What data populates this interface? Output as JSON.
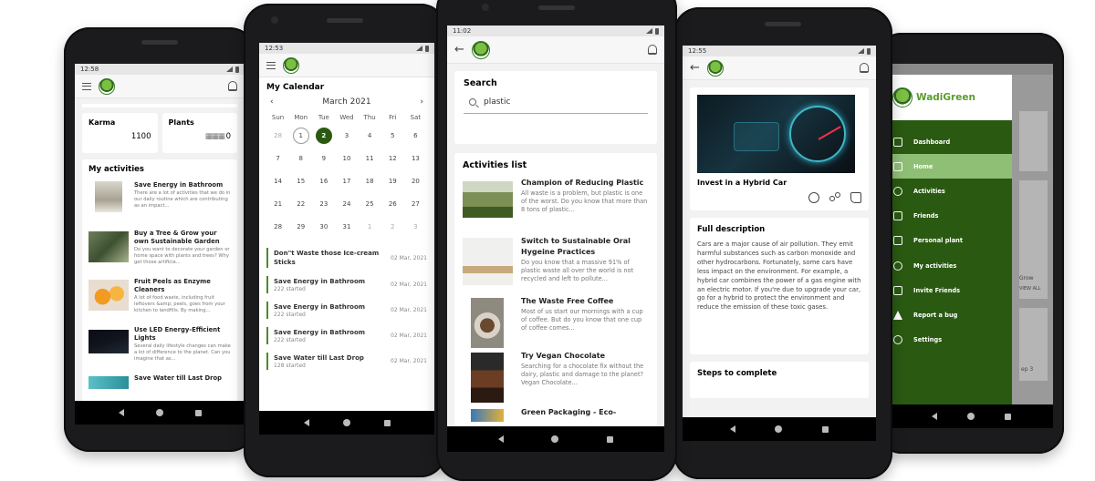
{
  "phone1": {
    "time": "12:58",
    "stats": [
      {
        "label": "Karma",
        "value": "1100"
      },
      {
        "label": "Plants",
        "value": "0"
      }
    ],
    "activities_heading": "My activities",
    "activities": [
      {
        "title": "Save Energy in Bathroom",
        "desc": "There are a lot of activities that we do in our daily routine which are contributing as an impact..."
      },
      {
        "title": "Buy a Tree & Grow your own Sustainable Garden",
        "desc": "Do you want to decorate your garden or home space with plants and trees? Why get those artificia..."
      },
      {
        "title": "Fruit Peels as Enzyme Cleaners",
        "desc": "A lot of food waste, including fruit leftovers &amp; peels, goes from your kitchen to landfills. By making..."
      },
      {
        "title": "Use LED Energy-Efficient Lights",
        "desc": "Several daily lifestyle changes can make a lot of difference to the planet. Can you imagine that as..."
      },
      {
        "title": "Save Water till Last Drop",
        "desc": ""
      }
    ]
  },
  "phone2": {
    "time": "12:53",
    "heading": "My Calendar",
    "month": "March 2021",
    "weekdays": [
      "Sun",
      "Mon",
      "Tue",
      "Wed",
      "Thu",
      "Fri",
      "Sat"
    ],
    "days": [
      "28",
      "1",
      "2",
      "3",
      "4",
      "5",
      "6",
      "7",
      "8",
      "9",
      "10",
      "11",
      "12",
      "13",
      "14",
      "15",
      "16",
      "17",
      "18",
      "19",
      "20",
      "21",
      "22",
      "23",
      "24",
      "25",
      "26",
      "27",
      "28",
      "29",
      "30",
      "31",
      "1",
      "2",
      "3"
    ],
    "events": [
      {
        "title": "Don\"t Waste those Ice-cream Sticks",
        "sub": "",
        "date": "02 Mar, 2021"
      },
      {
        "title": "Save Energy in Bathroom",
        "sub": "222 started",
        "date": "02 Mar, 2021"
      },
      {
        "title": "Save Energy in Bathroom",
        "sub": "222 started",
        "date": "02 Mar, 2021"
      },
      {
        "title": "Save Energy in Bathroom",
        "sub": "222 started",
        "date": "02 Mar, 2021"
      },
      {
        "title": "Save Water till Last Drop",
        "sub": "128 started",
        "date": "02 Mar, 2021"
      }
    ]
  },
  "phone3": {
    "time": "11:02",
    "search_heading": "Search",
    "search_value": "plastic",
    "list_heading": "Activities list",
    "items": [
      {
        "title": "Champion of Reducing Plastic",
        "desc": "All waste is a problem, but plastic is one of the worst. Do you know that more than 8 tons of plastic..."
      },
      {
        "title": "Switch to Sustainable Oral Hygeine Practices",
        "desc": "Do you know that a massive 91% of plastic waste all over the world is not recycled and left to pollute..."
      },
      {
        "title": "The Waste Free Coffee",
        "desc": "Most of us start our mornings with a cup of coffee. But do you know that one cup of coffee comes..."
      },
      {
        "title": "Try Vegan Chocolate",
        "desc": "Searching for a chocolate fix without the dairy, plastic and damage to the planet? Vegan Chocolate..."
      },
      {
        "title": "Green Packaging - Eco-",
        "desc": ""
      }
    ]
  },
  "phone4": {
    "time": "12:55",
    "title": "Invest in a Hybrid Car",
    "desc_heading": "Full description",
    "description": "Cars are a major cause of air pollution. They emit harmful substances such as carbon monoxide and other hydrocarbons. Fortunately, some cars have less impact on the environment. For example, a hybrid car combines the power of a gas engine with an electric motor. If you're due to upgrade your car, go for a hybrid to protect the environment and reduce the emission of these toxic gases.",
    "steps_heading": "Steps to complete"
  },
  "phone5": {
    "brand": "WadiGreen",
    "menu": [
      {
        "label": "Dashboard",
        "icon": "grid-icon"
      },
      {
        "label": "Home",
        "icon": "home-icon"
      },
      {
        "label": "Activities",
        "icon": "globe-icon"
      },
      {
        "label": "Friends",
        "icon": "friends-icon"
      },
      {
        "label": "Personal plant",
        "icon": "plant-icon"
      },
      {
        "label": "My activities",
        "icon": "globe-icon"
      },
      {
        "label": "Invite Friends",
        "icon": "invite-icon"
      },
      {
        "label": "Report a bug",
        "icon": "warning-icon"
      },
      {
        "label": "Settings",
        "icon": "gear-icon"
      }
    ],
    "bg_texts": [
      "Grow",
      "VIEW ALL",
      "ep 3"
    ]
  },
  "colors": {
    "brand_green": "#2a5a12",
    "accent_green": "#5a9c2c",
    "active_menu": "#8fbf75"
  }
}
